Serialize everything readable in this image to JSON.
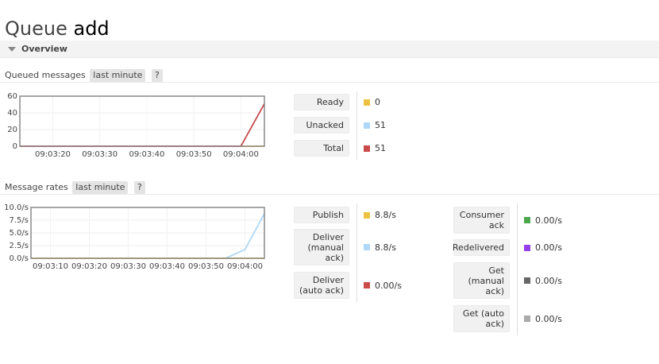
{
  "page": {
    "title_prefix": "Queue",
    "queue_name": "add"
  },
  "overview_section": {
    "label": "Overview"
  },
  "queued_messages": {
    "heading": "Queued messages",
    "range_label": "last minute",
    "help_label": "?",
    "legend": [
      {
        "label": "Ready",
        "value": "0",
        "color": "#edc240"
      },
      {
        "label": "Unacked",
        "value": "51",
        "color": "#afd8f8"
      },
      {
        "label": "Total",
        "value": "51",
        "color": "#cb4b4b"
      }
    ]
  },
  "message_rates": {
    "heading": "Message rates",
    "range_label": "last minute",
    "help_label": "?",
    "legend_left": [
      {
        "label": "Publish",
        "value": "8.8/s",
        "color": "#edc240"
      },
      {
        "label": "Deliver (manual ack)",
        "value": "8.8/s",
        "color": "#afd8f8"
      },
      {
        "label": "Deliver (auto ack)",
        "value": "0.00/s",
        "color": "#cb4b4b"
      }
    ],
    "legend_right": [
      {
        "label": "Consumer ack",
        "value": "0.00/s",
        "color": "#4da74d"
      },
      {
        "label": "Redelivered",
        "value": "0.00/s",
        "color": "#9440ed"
      },
      {
        "label": "Get (manual ack)",
        "value": "0.00/s",
        "color": "#666666"
      },
      {
        "label": "Get (auto ack)",
        "value": "0.00/s",
        "color": "#aaaaaa"
      }
    ]
  },
  "chart_data": [
    {
      "type": "line",
      "x_ticks": [
        "09:03:20",
        "09:03:30",
        "09:03:40",
        "09:03:50",
        "09:04:00"
      ],
      "y_ticks": [
        "0",
        "20",
        "40",
        "60"
      ],
      "ylim": [
        0,
        60
      ],
      "xlim": [
        "09:03:13",
        "09:04:05"
      ],
      "grid": true,
      "series": [
        {
          "name": "Ready",
          "color": "#edc240",
          "x": [
            "09:03:13",
            "09:04:00",
            "09:04:05"
          ],
          "values": [
            0,
            0,
            0
          ]
        },
        {
          "name": "Unacked",
          "color": "#afd8f8",
          "x": [
            "09:03:13",
            "09:04:00",
            "09:04:05"
          ],
          "values": [
            0,
            0,
            51
          ]
        },
        {
          "name": "Total",
          "color": "#cb4b4b",
          "x": [
            "09:03:13",
            "09:04:00",
            "09:04:05"
          ],
          "values": [
            0,
            0,
            51
          ]
        }
      ]
    },
    {
      "type": "line",
      "x_ticks": [
        "09:03:10",
        "09:03:20",
        "09:03:30",
        "09:03:40",
        "09:03:50",
        "09:04:00"
      ],
      "y_ticks": [
        "0.0/s",
        "2.5/s",
        "5.0/s",
        "7.5/s",
        "10.0/s"
      ],
      "ylim": [
        0,
        10
      ],
      "xlim": [
        "09:03:05",
        "09:04:05"
      ],
      "grid": true,
      "series": [
        {
          "name": "Deliver (manual ack)",
          "color": "#afd8f8",
          "x": [
            "09:03:05",
            "09:03:55",
            "09:04:00",
            "09:04:05"
          ],
          "values": [
            0,
            0,
            1.7,
            8.8
          ]
        },
        {
          "name": "Publish",
          "color": "#edc240",
          "x": [
            "09:03:05",
            "09:03:55",
            "09:04:00",
            "09:04:05"
          ],
          "values": [
            0,
            0,
            0,
            0
          ]
        }
      ]
    }
  ]
}
